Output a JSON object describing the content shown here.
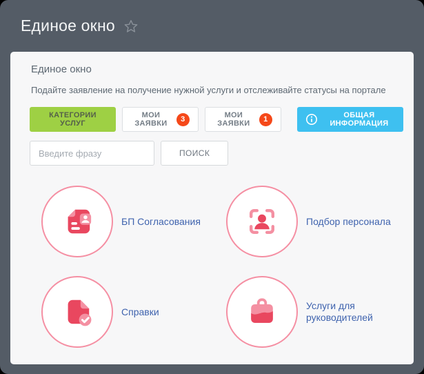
{
  "header": {
    "title": "Единое окно"
  },
  "card": {
    "title": "Единое окно",
    "subtitle": "Подайте заявление на получение нужной услуги и отслеживайте статусы на портале",
    "tabs": [
      {
        "label": "КАТЕГОРИИ УСЛУГ"
      },
      {
        "label": "МОИ ЗАЯВКИ",
        "badge": "3"
      },
      {
        "label": "МОИ ЗАЯВКИ",
        "badge": "1"
      },
      {
        "label": "ОБЩАЯ ИНФОРМАЦИЯ"
      }
    ],
    "search": {
      "placeholder": "Введите фразу",
      "value": "",
      "button": "ПОИСК"
    },
    "services": [
      {
        "label": "БП Согласования",
        "icon": "document-person-icon"
      },
      {
        "label": "Подбор персонала",
        "icon": "person-scan-icon"
      },
      {
        "label": "Справки",
        "icon": "document-check-icon"
      },
      {
        "label": "Услуги для руководителей",
        "icon": "briefcase-icon"
      }
    ]
  },
  "colors": {
    "window_bg": "#545c66",
    "card_bg": "#f7f7f8",
    "accent_green": "#9ed044",
    "accent_blue": "#3ec0f0",
    "badge_red": "#f54819",
    "icon_dark_pink": "#e9475f",
    "icon_light_pink": "#f490a2",
    "circle_border": "#f58fa3",
    "service_label_blue": "#3f63ae"
  }
}
